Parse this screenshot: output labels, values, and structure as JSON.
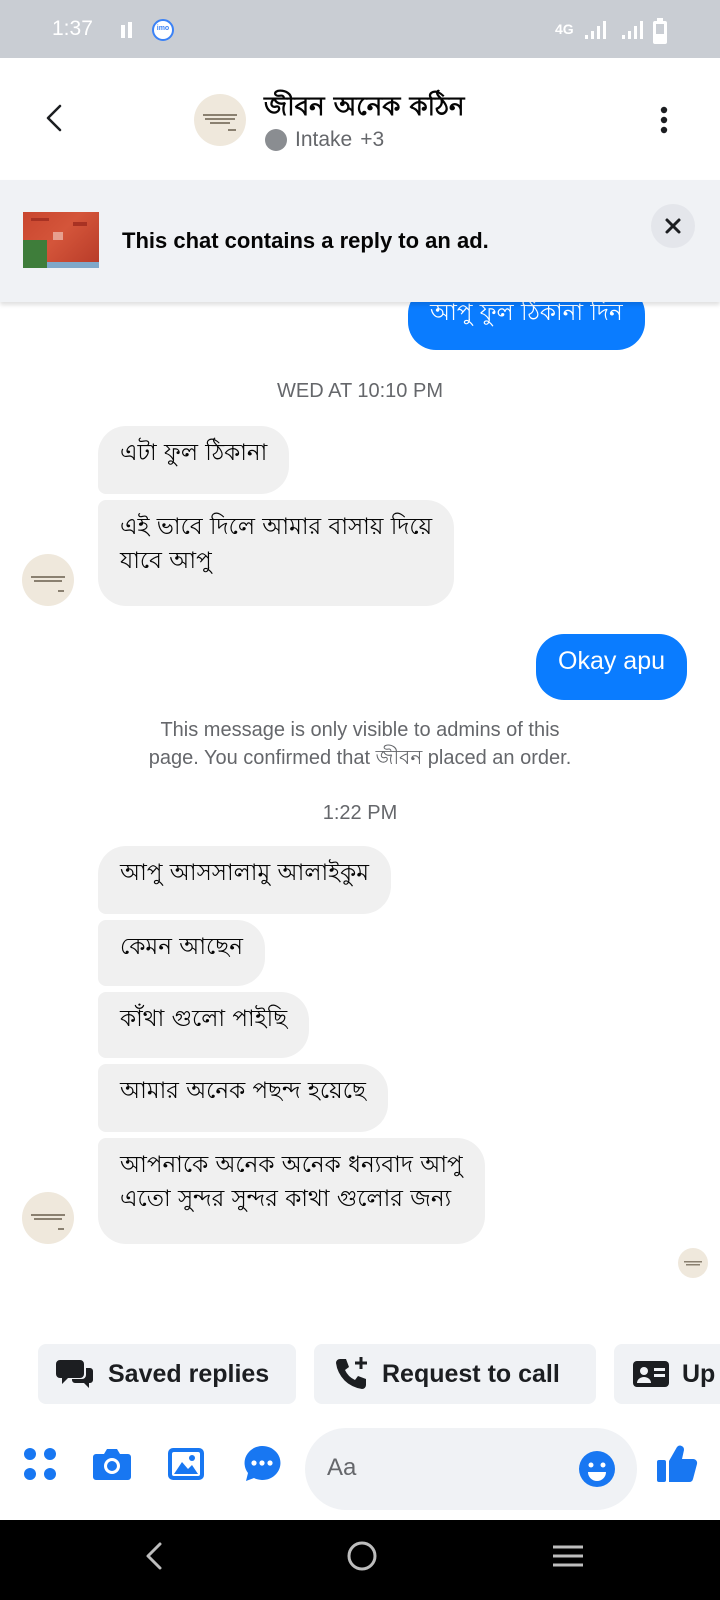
{
  "status_bar": {
    "time": "1:37",
    "network": "4G",
    "imo_badge": "imo"
  },
  "header": {
    "name": "জীবন অনেক কঠিন",
    "status": "Intake",
    "extra_count": "+3"
  },
  "ad_banner": {
    "text": "This chat contains a reply to an ad."
  },
  "messages": {
    "out_1": "আপু ফুল ঠিকানা দিন",
    "ts_1": "WED AT 10:10 PM",
    "in_1": "এটা ফুল ঠিকানা",
    "in_2_line1": "এই ভাবে দিলে আমার বাসায় দিয়ে",
    "in_2_line2": "যাবে আপু",
    "out_2": "Okay apu",
    "system_line1": "This message is only visible to admins of this",
    "system_line2": "page. You confirmed that জীবন placed an order.",
    "ts_2": "1:22 PM",
    "in_3": "আপু আসসালামু আলাইকুম",
    "in_4": "কেমন আছেন",
    "in_5": "কাঁথা গুলো পাইছি",
    "in_6": "আমার অনেক পছন্দ হয়েছে",
    "in_7_line1": "আপনাকে অনেক অনেক ধন্যবাদ আপু",
    "in_7_line2": "এতো সুন্দর সুন্দর কাথা গুলোর জন্য"
  },
  "quick_actions": {
    "saved_replies": "Saved replies",
    "request_to_call": "Request to call",
    "update": "Up"
  },
  "composer": {
    "placeholder": "Aa"
  },
  "colors": {
    "accent": "#0a7cff",
    "icon_blue": "#1877f2",
    "incoming_bubble": "#f0f0f0",
    "status_bar": "#c9cdd3"
  }
}
